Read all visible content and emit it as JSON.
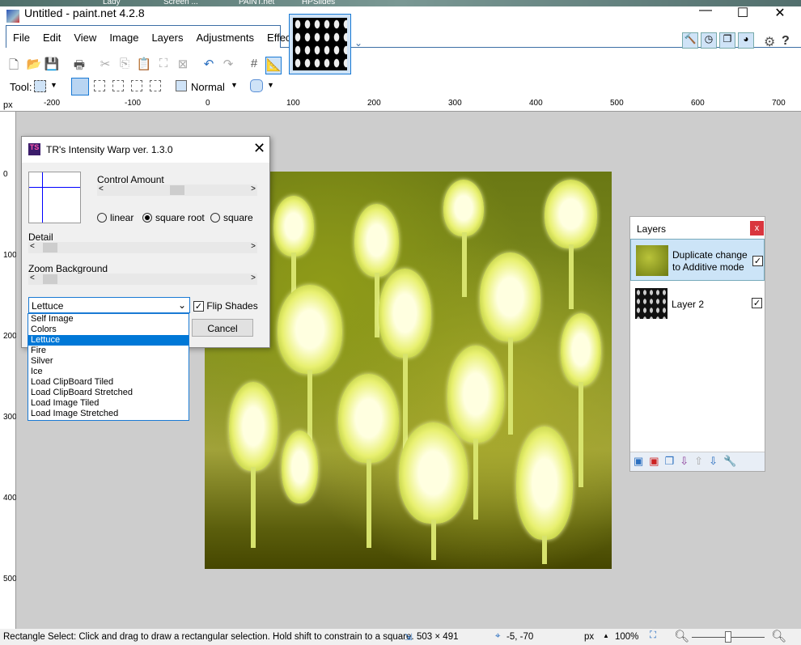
{
  "desktop": {
    "items": [
      "Lady",
      "Screen ...",
      "PAINT.net",
      "HPSlides"
    ]
  },
  "window": {
    "title": "Untitled - paint.net 4.2.8",
    "minimize": "—",
    "maximize": "☐",
    "close": "✕"
  },
  "menu": [
    "File",
    "Edit",
    "View",
    "Image",
    "Layers",
    "Adjustments",
    "Effects"
  ],
  "toolbar": {
    "tool_label": "Tool:",
    "blend_mode": "Normal"
  },
  "ruler": {
    "unit": "px",
    "h_ticks": [
      "-200",
      "-100",
      "0",
      "100",
      "200",
      "300",
      "400",
      "500",
      "600",
      "700"
    ],
    "v_ticks": [
      "0",
      "100",
      "200",
      "300",
      "400",
      "500"
    ]
  },
  "dialog": {
    "title": "TR's Intensity Warp ver. 1.3.0",
    "control_amount": "Control Amount",
    "radios": [
      "linear",
      "square root",
      "square"
    ],
    "selected_radio": "square root",
    "detail": "Detail",
    "zoom_background": "Zoom Background",
    "dropdown_value": "Lettuce",
    "flip_shades": "Flip Shades",
    "flip_checked": true,
    "cancel": "Cancel",
    "options": [
      "Self Image",
      "Colors",
      "Lettuce",
      "Fire",
      "Silver",
      "Ice",
      "Load ClipBoard Tiled",
      "Load ClipBoard Stretched",
      "Load Image Tiled",
      "Load Image Stretched"
    ]
  },
  "layers": {
    "title": "Layers",
    "items": [
      {
        "name": "Duplicate change to Additive mode",
        "visible": true,
        "selected": true
      },
      {
        "name": "Layer 2",
        "visible": true,
        "selected": false
      }
    ]
  },
  "status": {
    "hint": "Rectangle Select: Click and drag to draw a rectangular selection. Hold shift to constrain to a square.",
    "size": "503 × 491",
    "cursor": "-5, -70",
    "unit": "px",
    "zoom": "100%",
    "zoom_level_percent": 100
  }
}
